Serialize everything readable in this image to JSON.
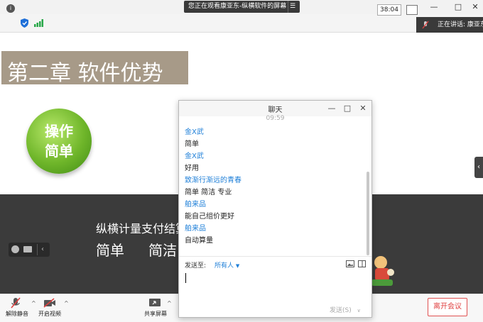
{
  "top_bar": {
    "share_notice": "您正在观看康亚东-纵横软件的屏幕",
    "menu_glyph": "☰",
    "minimize": "—",
    "maximize": "□",
    "close": "✕"
  },
  "status_bar": {
    "timer": "38:04",
    "speaker_label": "正在讲话: 康亚东"
  },
  "slide": {
    "title": "第二章 软件优势",
    "badge_line1": "操作",
    "badge_line2": "简单",
    "band_line": "纵横计量支付结算",
    "band_word1": "简单",
    "band_word2": "简洁"
  },
  "chat": {
    "title": "聊天",
    "time": "09:59",
    "messages": [
      {
        "sender": "金X武",
        "text": "简单"
      },
      {
        "sender": "金X武",
        "text": "好用"
      },
      {
        "sender": "致渐行渐远的青春",
        "text": "简单 简洁 专业"
      },
      {
        "sender": "舶来品",
        "text": "能自己组价更好"
      },
      {
        "sender": "舶来品",
        "text": "自动算量"
      }
    ],
    "send_to_label": "发送至:",
    "recipient": "所有人",
    "send_button": "发送(S)"
  },
  "toolbar": {
    "unmute": "解除静音",
    "start_video": "开启视频",
    "share_screen": "共享屏幕",
    "leave_meeting": "离开会议"
  },
  "colors": {
    "accent_blue": "#1e7fd8",
    "leave_red": "#e04040",
    "slide_title_bg": "#a79a88",
    "band_bg": "#3b3b3b"
  }
}
